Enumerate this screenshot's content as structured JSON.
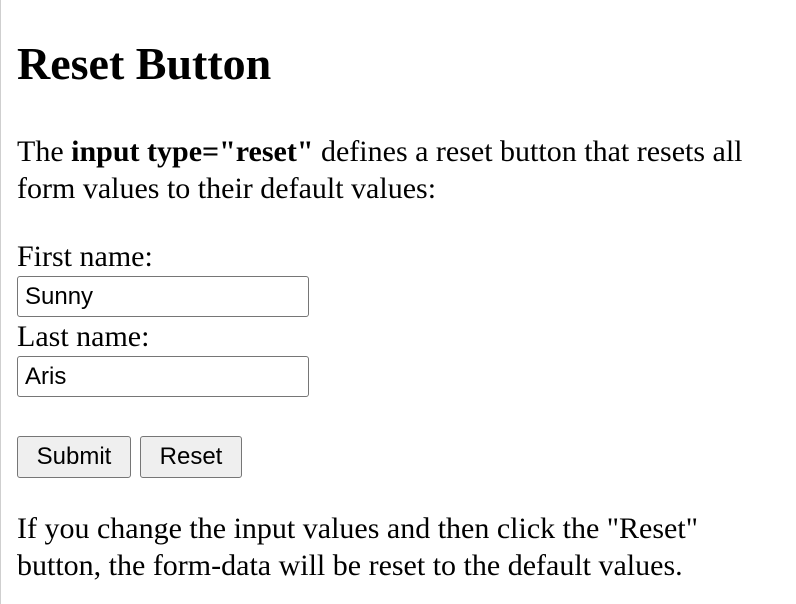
{
  "heading": "Reset Button",
  "intro": {
    "prefix": "The ",
    "bold": "input type=\"reset\"",
    "suffix": " defines a reset button that resets all form values to their default values:"
  },
  "form": {
    "first_name_label": "First name:",
    "first_name_value": "Sunny",
    "last_name_label": "Last name:",
    "last_name_value": "Aris",
    "submit_label": "Submit",
    "reset_label": "Reset"
  },
  "outro": "If you change the input values and then click the \"Reset\" button, the form-data will be reset to the default values."
}
